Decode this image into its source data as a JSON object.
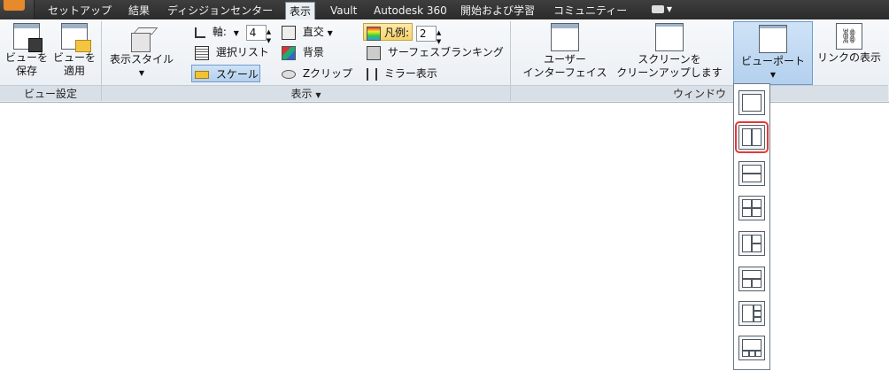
{
  "tabs": [
    {
      "label": "セットアップ",
      "active": false
    },
    {
      "label": "結果",
      "active": false
    },
    {
      "label": "ディシジョンセンター",
      "active": false
    },
    {
      "label": "表示",
      "active": true
    },
    {
      "label": "Vault",
      "active": false
    },
    {
      "label": "Autodesk 360",
      "active": false
    },
    {
      "label": "開始および学習",
      "active": false
    },
    {
      "label": "コミュニティー",
      "active": false
    }
  ],
  "panels": {
    "view_settings": {
      "title": "ビュー設定",
      "buttons": [
        {
          "line1": "ビューを",
          "line2": "保存",
          "icon": "save-view-icon"
        },
        {
          "line1": "ビューを",
          "line2": "適用",
          "icon": "apply-view-icon"
        }
      ]
    },
    "display": {
      "title": "表示",
      "style_button": {
        "label": "表示スタイル",
        "icon": "cube-icon"
      },
      "axis": {
        "label": "軸:",
        "value": "4"
      },
      "ortho": {
        "label": "直交"
      },
      "select_list": {
        "label": "選択リスト"
      },
      "background": {
        "label": "背景"
      },
      "scale": {
        "label": "スケール"
      },
      "zclip": {
        "label": "Zクリップ"
      },
      "legend": {
        "label": "凡例:",
        "value": "2"
      },
      "surface_blanking": {
        "label": "サーフェスブランキング"
      },
      "mirror": {
        "label": "ミラー表示"
      }
    },
    "window": {
      "title": "ウィンドウ",
      "user_interface": {
        "line1": "ユーザー",
        "line2": "インターフェイス"
      },
      "clean_screen": {
        "line1": "スクリーンを",
        "line2": "クリーンアップします"
      },
      "viewport": {
        "label": "ビューポート"
      },
      "link_view": {
        "label": "リンクの表示"
      }
    }
  },
  "viewport_layouts": [
    "single",
    "two-vertical",
    "two-horizontal",
    "four-grid",
    "three-left-split",
    "three-top-split",
    "left-big-three",
    "bottom-three"
  ],
  "selected_layout": "two-vertical",
  "colors": {
    "tabbar": "#333333",
    "ribbon": "#eef2f6",
    "highlight_outline": "#e53935",
    "accent": "#e8892c"
  }
}
